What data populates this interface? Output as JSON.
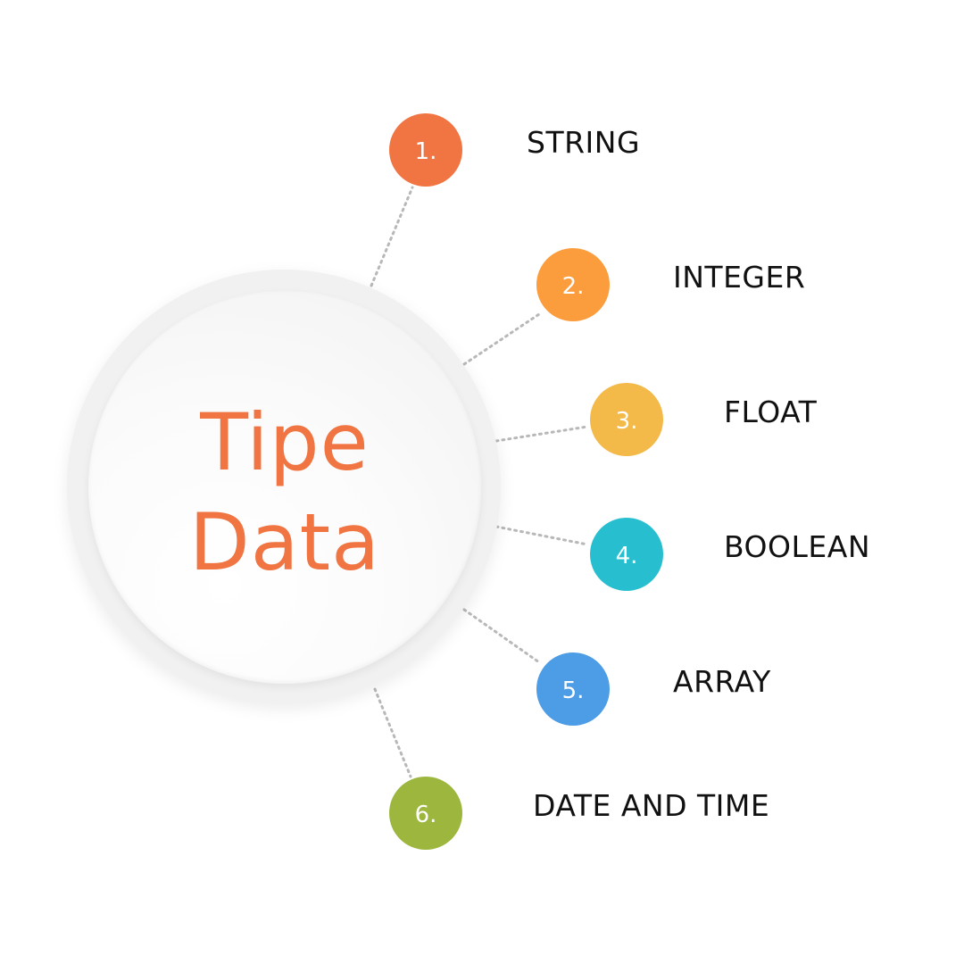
{
  "hub": {
    "title_line1": "Tipe",
    "title_line2": "Data",
    "title_color": "#f07542"
  },
  "items": [
    {
      "number": "1.",
      "label": "STRING",
      "color": "#f07542"
    },
    {
      "number": "2.",
      "label": "INTEGER",
      "color": "#fb9d3c"
    },
    {
      "number": "3.",
      "label": "FLOAT",
      "color": "#f3b949"
    },
    {
      "number": "4.",
      "label": "BOOLEAN",
      "color": "#27bfcf"
    },
    {
      "number": "5.",
      "label": "ARRAY",
      "color": "#4d9de6"
    },
    {
      "number": "6.",
      "label": "DATE AND TIME",
      "color": "#9cb63e"
    }
  ]
}
